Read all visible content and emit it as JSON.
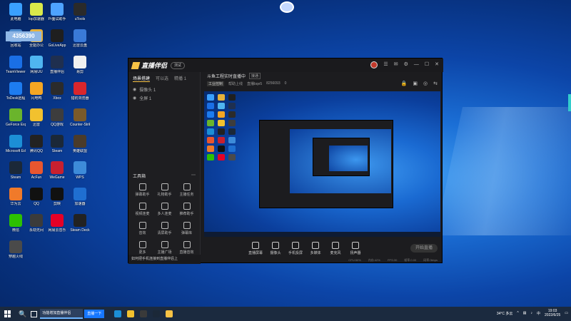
{
  "desktop": {
    "overlay_text": "4356390",
    "icons": [
      {
        "label": "此电脑",
        "color": "#3aa0ff"
      },
      {
        "label": "lop加速器",
        "color": "#d9e94a"
      },
      {
        "label": "Pr面试助手",
        "color": "#4ea3ff"
      },
      {
        "label": "uTools",
        "color": "#2a2a2a"
      },
      {
        "label": "回收站",
        "color": "#4a87c9"
      },
      {
        "label": "全能办公",
        "color": "#e6b13a"
      },
      {
        "label": "GoLiveApp",
        "color": "#1f1f1f"
      },
      {
        "label": "迅雷云盘",
        "color": "#3a7ad8"
      },
      {
        "label": "TeamViewer",
        "color": "#1a6fe6"
      },
      {
        "label": "网易UU",
        "color": "#4fb5f0"
      },
      {
        "label": "直播伴侣",
        "color": "#1f2f4f"
      },
      {
        "label": "易剪",
        "color": "#f0f0f0"
      },
      {
        "label": "ToDesk远程",
        "color": "#1d7cf0"
      },
      {
        "label": "闪电鸭",
        "color": "#f5a623"
      },
      {
        "label": "Xbox",
        "color": "#2b2b2b"
      },
      {
        "label": "猎豹浏览器",
        "color": "#d9262c"
      },
      {
        "label": "GeForce Experience",
        "color": "#6ab42c"
      },
      {
        "label": "迅雷",
        "color": "#f2c12e"
      },
      {
        "label": "QQ游戏",
        "color": "#3d3d3d"
      },
      {
        "label": "Counter-Strike",
        "color": "#7a5a2a"
      },
      {
        "label": "Microsoft Edge",
        "color": "#1c8fd6"
      },
      {
        "label": "腾讯QQ",
        "color": "#222"
      },
      {
        "label": "Steam",
        "color": "#1b2838"
      },
      {
        "label": "英雄联盟",
        "color": "#4a3b2a"
      },
      {
        "label": "Steam",
        "color": "#1b2838"
      },
      {
        "label": "AcFun",
        "color": "#e9562f"
      },
      {
        "label": "WeGame",
        "color": "#c8202f"
      },
      {
        "label": "WPS",
        "color": "#3d8bd9"
      },
      {
        "label": "华为云",
        "color": "#f07a2a"
      },
      {
        "label": "QQ",
        "color": "#111"
      },
      {
        "label": "剪映",
        "color": "#111"
      },
      {
        "label": "加速器",
        "color": "#1f6fd1"
      },
      {
        "label": "微信",
        "color": "#2dc100"
      },
      {
        "label": "永劫无间",
        "color": "#3b3b3b"
      },
      {
        "label": "网易云音乐",
        "color": "#e60026"
      },
      {
        "label": "Steam Deck",
        "color": "#222"
      },
      {
        "label": "穿越火线",
        "color": "#4a4a4a"
      }
    ]
  },
  "window": {
    "app_name": "直播伴侣",
    "version_badge": "测试",
    "left_tabs": [
      "场景搭建",
      "可以选",
      "精播 1"
    ],
    "scenes": [
      "摄像头 1",
      "全屏 1"
    ],
    "tools_header": "工具箱",
    "tools": [
      "弹幕助手",
      "礼物助手",
      "主播任务",
      "视频连麦",
      "多人连麦",
      "推荐助手",
      "音效",
      "清屏助手",
      "弹幕库",
      "更多",
      "主播广场",
      "直播音效"
    ],
    "notice": "如何把手机连接到直播伴侣上",
    "stream_title": "斗鱼工程实时直播中",
    "stream_tag": "接通",
    "sub_info": [
      "工业控制",
      "帮助上线",
      "直播bqe5",
      "8256093",
      "0"
    ],
    "controls": [
      "直播屏幕",
      "摄像头",
      "手机投屏",
      "多媒体",
      "麦克风",
      "扬声器"
    ],
    "go_live": "开始直播",
    "status": [
      "CPU:50%",
      "内存:42%",
      "FPS:30",
      "帧率:0.00",
      "码率:0kbps"
    ]
  },
  "taskbar": {
    "search_icon": "🔍",
    "active_tab": "功能增加直播伴侣",
    "tab_button": "直播一下",
    "weather": "34°C 多云",
    "time": "19:03",
    "date": "2022/6/25",
    "lang": "中"
  }
}
